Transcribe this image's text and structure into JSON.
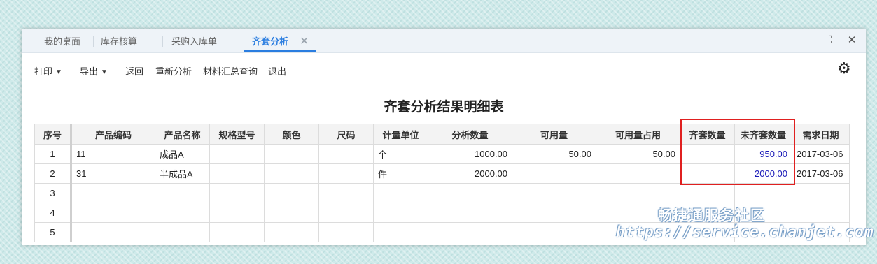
{
  "tabs": [
    {
      "label": "我的桌面"
    },
    {
      "label": "库存核算"
    },
    {
      "label": "采购入库单"
    },
    {
      "label": "齐套分析"
    }
  ],
  "active_tab": "齐套分析",
  "toolbar": {
    "print": "打印",
    "export": "导出",
    "back": "返回",
    "reanalyze": "重新分析",
    "material_summary": "材料汇总查询",
    "exit": "退出"
  },
  "report": {
    "title": "齐套分析结果明细表",
    "columns": [
      "序号",
      "产品编码",
      "产品名称",
      "规格型号",
      "颜色",
      "尺码",
      "计量单位",
      "分析数量",
      "可用量",
      "可用量占用",
      "齐套数量",
      "未齐套数量",
      "需求日期"
    ],
    "rows": [
      [
        "1",
        "11",
        "成品A",
        "",
        "",
        "",
        "个",
        "1000.00",
        "50.00",
        "50.00",
        "",
        "950.00",
        "2017-03-06"
      ],
      [
        "2",
        "31",
        "半成品A",
        "",
        "",
        "",
        "件",
        "2000.00",
        "",
        "",
        "",
        "2000.00",
        "2017-03-06"
      ],
      [
        "3",
        "",
        "",
        "",
        "",
        "",
        "",
        "",
        "",
        "",
        "",
        "",
        ""
      ],
      [
        "4",
        "",
        "",
        "",
        "",
        "",
        "",
        "",
        "",
        "",
        "",
        "",
        ""
      ],
      [
        "5",
        "",
        "",
        "",
        "",
        "",
        "",
        "",
        "",
        "",
        "",
        "",
        ""
      ]
    ]
  },
  "watermark": {
    "line1": "畅捷通服务社区",
    "line2": "https://service.chanjet.com"
  },
  "colors": {
    "accent": "#2a7de0",
    "highlight_border": "#e02020",
    "unfulfilled_text": "#1a1ab8"
  },
  "icons": [
    "maximize-icon",
    "close-icon",
    "gear-icon"
  ]
}
